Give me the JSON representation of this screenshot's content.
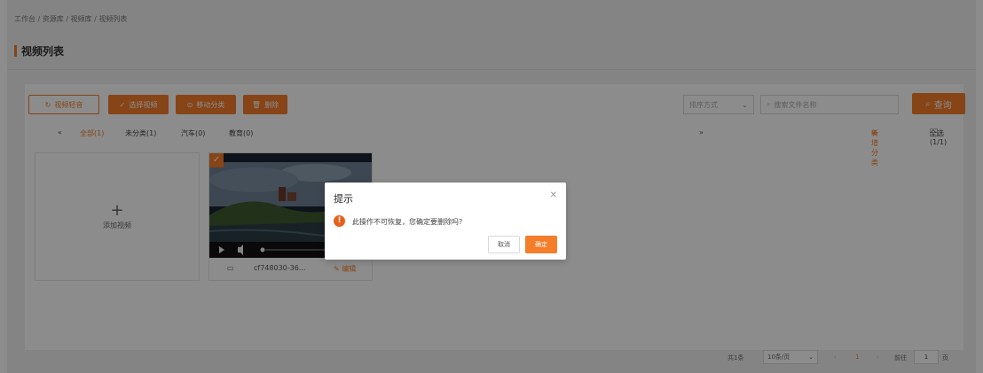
{
  "breadcrumb": "工作台 / 资源库 / 视频库 / 视频列表",
  "page_title": "视频列表",
  "toolbar": {
    "upload_label": "视频轻音",
    "select_label": "选择视频",
    "move_label": "移动分类",
    "delete_label": "删除",
    "sort_placeholder": "排序方式",
    "search_placeholder": "搜索文件名称",
    "query_label": "查询"
  },
  "categories": [
    "全部(1)",
    "未分类(1)",
    "汽车(0)",
    "教育(0)"
  ],
  "category_actions": {
    "new_category": "新增分类",
    "select_all": "全选(1/1)"
  },
  "add_video_label": "添加视频",
  "video": {
    "filename": "cf748030-36...",
    "edit_label": "编辑"
  },
  "dialog": {
    "title": "提示",
    "message": "此操作不可恢复，您确定要删除吗?",
    "cancel_label": "取消",
    "confirm_label": "确定"
  },
  "pagination": {
    "total": "共1条",
    "page_size": "10条/页",
    "current_page": "1",
    "goto_label": "前往",
    "goto_value": "1",
    "page_suffix": "页"
  },
  "colors": {
    "accent": "#f47d2a",
    "warning": "#e8611a"
  }
}
